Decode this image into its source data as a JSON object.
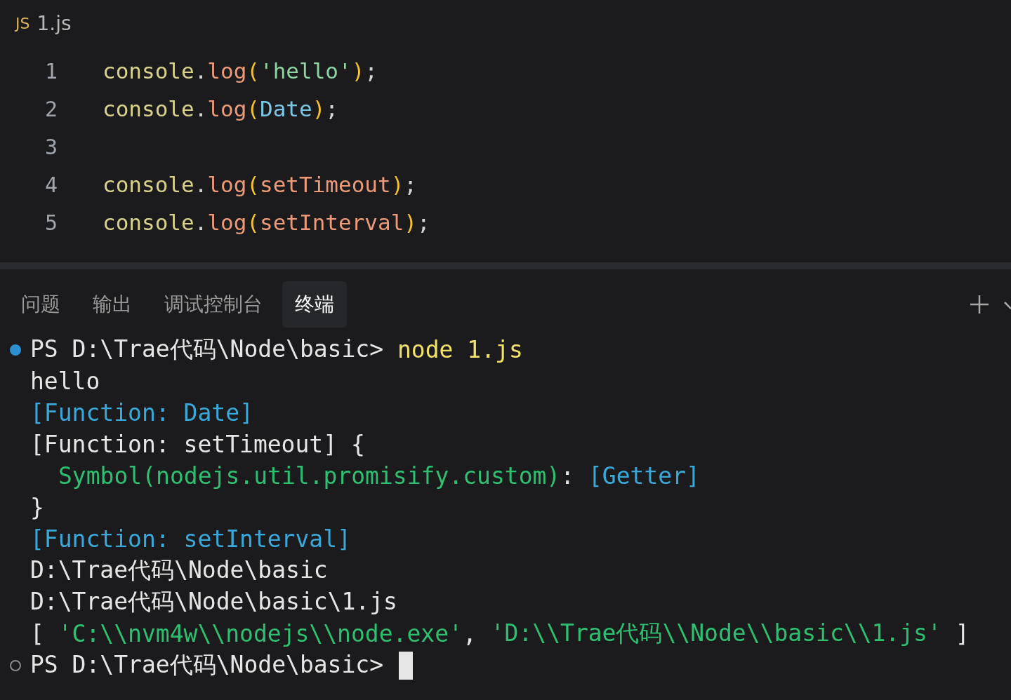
{
  "editor": {
    "file_tab": {
      "badge": "JS",
      "name": "1.js"
    },
    "lines": [
      {
        "number": "1",
        "tokens": [
          {
            "kind": "object",
            "text": "console"
          },
          {
            "kind": "punct",
            "text": "."
          },
          {
            "kind": "method",
            "text": "log"
          },
          {
            "kind": "paren",
            "text": "("
          },
          {
            "kind": "string",
            "text": "'hello'"
          },
          {
            "kind": "paren",
            "text": ")"
          },
          {
            "kind": "punct",
            "text": ";"
          }
        ]
      },
      {
        "number": "2",
        "tokens": [
          {
            "kind": "object",
            "text": "console"
          },
          {
            "kind": "punct",
            "text": "."
          },
          {
            "kind": "method",
            "text": "log"
          },
          {
            "kind": "paren",
            "text": "("
          },
          {
            "kind": "class",
            "text": "Date"
          },
          {
            "kind": "paren",
            "text": ")"
          },
          {
            "kind": "punct",
            "text": ";"
          }
        ]
      },
      {
        "number": "3"
      },
      {
        "number": "4",
        "tokens": [
          {
            "kind": "object",
            "text": "console"
          },
          {
            "kind": "punct",
            "text": "."
          },
          {
            "kind": "method",
            "text": "log"
          },
          {
            "kind": "paren",
            "text": "("
          },
          {
            "kind": "method",
            "text": "setTimeout"
          },
          {
            "kind": "paren",
            "text": ")"
          },
          {
            "kind": "punct",
            "text": ";"
          }
        ]
      },
      {
        "number": "5",
        "tokens": [
          {
            "kind": "object",
            "text": "console"
          },
          {
            "kind": "punct",
            "text": "."
          },
          {
            "kind": "method",
            "text": "log"
          },
          {
            "kind": "paren",
            "text": "("
          },
          {
            "kind": "method",
            "text": "setInterval"
          },
          {
            "kind": "paren",
            "text": ")"
          },
          {
            "kind": "punct",
            "text": ";"
          }
        ]
      }
    ]
  },
  "panel": {
    "tabs": [
      {
        "label": "问题",
        "selected": false
      },
      {
        "label": "输出",
        "selected": false
      },
      {
        "label": "调试控制台",
        "selected": false
      },
      {
        "label": "终端",
        "selected": true
      }
    ],
    "terminal": [
      {
        "marker_filled": true,
        "segments": [
          {
            "kind": "plain",
            "text": "PS D:\\Trae代码\\Node\\basic> "
          },
          {
            "kind": "command",
            "text": "node 1.js"
          }
        ]
      },
      {
        "segments": [
          {
            "kind": "plain",
            "text": "hello"
          }
        ]
      },
      {
        "segments": [
          {
            "kind": "cyan",
            "text": "[Function: Date]"
          }
        ]
      },
      {
        "segments": [
          {
            "kind": "plain",
            "text": "[Function: setTimeout] {"
          }
        ]
      },
      {
        "indented": true,
        "segments": [
          {
            "kind": "green",
            "text": "Symbol(nodejs.util.promisify.custom)"
          },
          {
            "kind": "plain",
            "text": ": "
          },
          {
            "kind": "cyan",
            "text": "[Getter]"
          }
        ]
      },
      {
        "segments": [
          {
            "kind": "plain",
            "text": "}"
          }
        ]
      },
      {
        "segments": [
          {
            "kind": "cyan",
            "text": "[Function: setInterval]"
          }
        ]
      },
      {
        "segments": [
          {
            "kind": "plain",
            "text": "D:\\Trae代码\\Node\\basic"
          }
        ]
      },
      {
        "segments": [
          {
            "kind": "plain",
            "text": "D:\\Trae代码\\Node\\basic\\1.js"
          }
        ]
      },
      {
        "segments": [
          {
            "kind": "plain",
            "text": "[ "
          },
          {
            "kind": "green",
            "text": "'C:\\\\nvm4w\\\\nodejs\\\\node.exe'"
          },
          {
            "kind": "plain",
            "text": ", "
          },
          {
            "kind": "green",
            "text": "'D:\\\\Trae代码\\\\Node\\\\basic\\\\1.js'"
          },
          {
            "kind": "plain",
            "text": " ]"
          }
        ]
      },
      {
        "marker_filled": false,
        "cursor": true,
        "segments": [
          {
            "kind": "plain",
            "text": "PS D:\\Trae代码\\Node\\basic> "
          }
        ]
      }
    ]
  }
}
